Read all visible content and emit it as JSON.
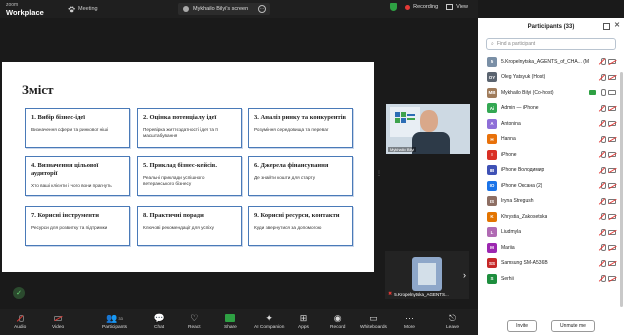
{
  "topbar": {
    "brand_small": "zoom",
    "brand_big": "Workplace",
    "meeting": "Meeting",
    "screen_tab": "Mykhailo Bilyi's screen",
    "recording": "Recording",
    "view": "View"
  },
  "slide": {
    "title": "Зміст",
    "cards": [
      {
        "title": "1. Вибір бізнес-ідеї",
        "desc": "Визначення сфери та ринкової ніші"
      },
      {
        "title": "2. Оцінка потенціалу ідеї",
        "desc": "Перевірка життєздатності ідеї та її масштабування"
      },
      {
        "title": "3. Аналіз ринку та конкурентів",
        "desc": "Розуміння середовища та переваг"
      },
      {
        "title": "4. Визначення цільової аудиторії",
        "desc": "Хто ваші клієнти і чого вони прагнуть"
      },
      {
        "title": "5. Приклад бізнес-кейсів.",
        "desc": "Реальні приклади успішного ветеранського бізнесу"
      },
      {
        "title": "6. Джерела фінансування",
        "desc": "Де знайти кошти для старту"
      },
      {
        "title": "7. Корисні інструменти",
        "desc": "Ресурси для розвитку та підтримки"
      },
      {
        "title": "8. Практичні поради",
        "desc": "Ключові рекомендації для успіху"
      },
      {
        "title": "9. Корисні ресурси, контакти",
        "desc": "Куди звернутися за допомогою"
      }
    ]
  },
  "camera_main": {
    "name": "Mykhailo Bilyi"
  },
  "camera_second": {
    "name": "5.Kropelnytska_AGENTS..."
  },
  "participants": {
    "header": "Participants (33)",
    "search_placeholder": "Find a participant",
    "list": [
      {
        "initials": "5",
        "name": "5.Kropelnytska_AGENTS_of_CHA... (Me)",
        "color": "#7a8fa6",
        "mic": "off",
        "cam": "off"
      },
      {
        "initials": "OY",
        "name": "Oleg Yatsyuk (Host)",
        "color": "#5b6470",
        "mic": "off",
        "cam": "off"
      },
      {
        "initials": "MB",
        "name": "Mykhailo Bilyi (Co-host)",
        "color": "#a07c5b",
        "mic": "on",
        "cam": "on",
        "share": true
      },
      {
        "initials": "Ai",
        "name": "Admin — iPhone",
        "color": "#34a853",
        "mic": "off",
        "cam": "off"
      },
      {
        "initials": "A",
        "name": "Antonina",
        "color": "#8e6fd8",
        "mic": "off",
        "cam": "off"
      },
      {
        "initials": "H",
        "name": "Hanna",
        "color": "#e8710a",
        "mic": "off",
        "cam": "off"
      },
      {
        "initials": "I",
        "name": "iPhone",
        "color": "#d93025",
        "mic": "off",
        "cam": "off"
      },
      {
        "initials": "IB",
        "name": "iPhone Володимир",
        "color": "#3f51b5",
        "mic": "off",
        "cam": "off"
      },
      {
        "initials": "IO",
        "name": "iPhone Оксана (2)",
        "color": "#1a73e8",
        "mic": "off",
        "cam": "off"
      },
      {
        "initials": "IS",
        "name": "Iryna Stregush",
        "color": "#8d6e63",
        "mic": "off",
        "cam": "off"
      },
      {
        "initials": "K",
        "name": "Khrystia_Zakosetska",
        "color": "#e37400",
        "mic": "off",
        "cam": "off"
      },
      {
        "initials": "L",
        "name": "Liudmyla",
        "color": "#b06ab3",
        "mic": "off",
        "cam": "off"
      },
      {
        "initials": "M",
        "name": "Mariia",
        "color": "#9c27b0",
        "mic": "off",
        "cam": "off"
      },
      {
        "initials": "SS",
        "name": "Samsung SM-A536B",
        "color": "#c62828",
        "mic": "off",
        "cam": "off"
      },
      {
        "initials": "S",
        "name": "Serhii",
        "color": "#1e8e3e",
        "mic": "off",
        "cam": "off"
      }
    ],
    "invite": "Invite",
    "unmute_me": "Unmute me"
  },
  "toolbar": {
    "audio": "Audio",
    "video": "Video",
    "participants": "Participants",
    "participants_count": "33",
    "chat": "Chat",
    "react": "React",
    "share": "Share",
    "ai_companion": "AI Companion",
    "apps": "Apps",
    "record": "Record",
    "whiteboards": "Whiteboards",
    "more": "More",
    "leave": "Leave"
  },
  "colors": {
    "accent_green": "#2ea043",
    "record_red": "#e53935",
    "card_border": "#4a7ab8"
  }
}
